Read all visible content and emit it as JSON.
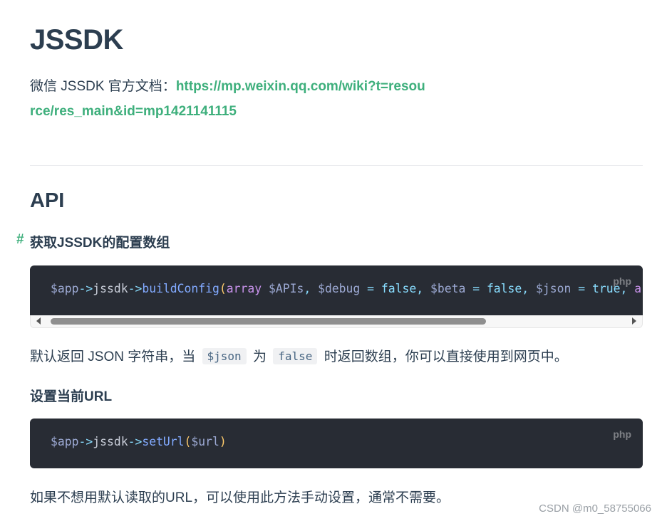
{
  "page": {
    "title": "JSSDK",
    "intro_text": "微信 JSSDK 官方文档：",
    "intro_link": "https://mp.weixin.qq.com/wiki?t=resource/res_main&id=mp1421141115",
    "section_title": "API"
  },
  "sections": [
    {
      "anchor": "#",
      "heading": "获取JSSDK的配置数组",
      "lang": "php",
      "code_tokens": [
        {
          "t": "$",
          "c": "tk-dollar"
        },
        {
          "t": "app",
          "c": "tk-var"
        },
        {
          "t": "->",
          "c": "tk-op"
        },
        {
          "t": "jssdk",
          "c": "tk-plain"
        },
        {
          "t": "->",
          "c": "tk-op"
        },
        {
          "t": "buildConfig",
          "c": "tk-fn"
        },
        {
          "t": "(",
          "c": "tk-paren"
        },
        {
          "t": "array",
          "c": "tk-type"
        },
        {
          "t": " $APIs",
          "c": "tk-var"
        },
        {
          "t": ",",
          "c": "tk-punc"
        },
        {
          "t": " $debug",
          "c": "tk-var"
        },
        {
          "t": " = ",
          "c": "tk-op"
        },
        {
          "t": "false",
          "c": "tk-bool"
        },
        {
          "t": ",",
          "c": "tk-punc"
        },
        {
          "t": " $beta",
          "c": "tk-var"
        },
        {
          "t": " = ",
          "c": "tk-op"
        },
        {
          "t": "false",
          "c": "tk-bool"
        },
        {
          "t": ",",
          "c": "tk-punc"
        },
        {
          "t": " $json",
          "c": "tk-var"
        },
        {
          "t": " = ",
          "c": "tk-op"
        },
        {
          "t": "true",
          "c": "tk-bool"
        },
        {
          "t": ",",
          "c": "tk-punc"
        },
        {
          "t": " array",
          "c": "tk-type"
        }
      ],
      "desc_before": "默认返回 JSON 字符串，当 ",
      "desc_code1": "$json",
      "desc_mid": " 为 ",
      "desc_code2": "false",
      "desc_after": " 时返回数组，你可以直接使用到网页中。"
    },
    {
      "heading": "设置当前URL",
      "lang": "php",
      "code_tokens": [
        {
          "t": "$",
          "c": "tk-dollar"
        },
        {
          "t": "app",
          "c": "tk-var"
        },
        {
          "t": "->",
          "c": "tk-op"
        },
        {
          "t": "jssdk",
          "c": "tk-plain"
        },
        {
          "t": "->",
          "c": "tk-op"
        },
        {
          "t": "setUrl",
          "c": "tk-fn"
        },
        {
          "t": "(",
          "c": "tk-paren"
        },
        {
          "t": "$url",
          "c": "tk-var"
        },
        {
          "t": ")",
          "c": "tk-paren"
        }
      ],
      "desc": "如果不想用默认读取的URL，可以使用此方法手动设置，通常不需要。"
    }
  ],
  "scrollbar": {
    "thumb_fraction": 0.76
  },
  "watermark": "CSDN @m0_58755066"
}
